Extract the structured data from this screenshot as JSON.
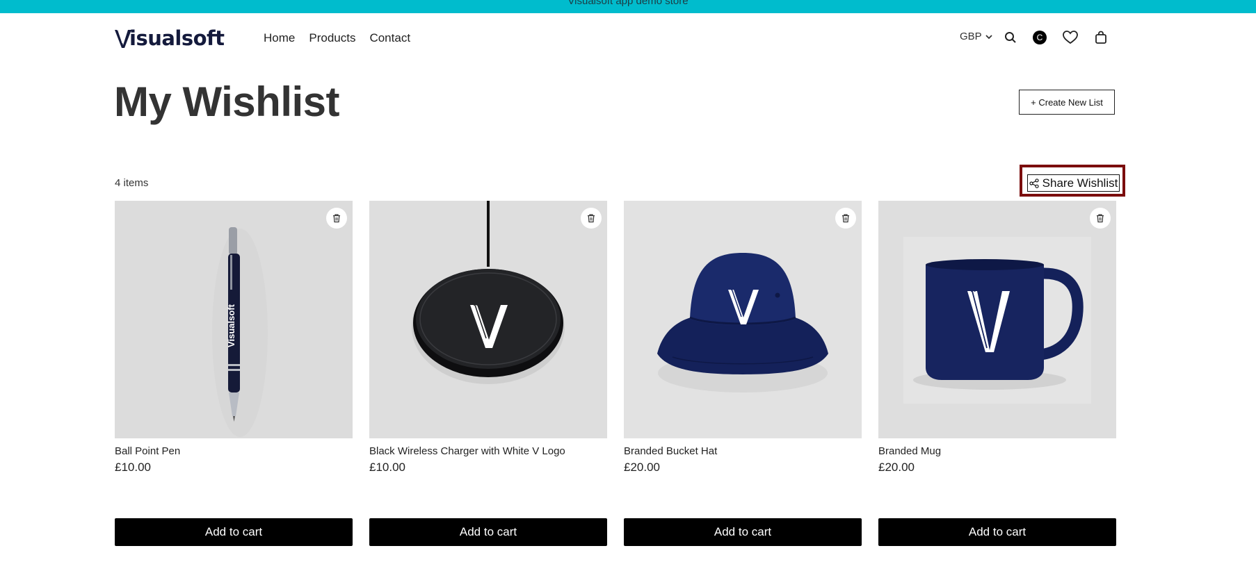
{
  "announcement": "Visualsoft app demo store",
  "header": {
    "logo_text": "isualsoft",
    "logo_letter": "V",
    "nav": [
      "Home",
      "Products",
      "Contact"
    ],
    "currency": "GBP",
    "account_initial": "C",
    "icons": [
      "search-icon",
      "account-icon",
      "heart-icon",
      "bag-icon"
    ]
  },
  "page": {
    "title": "My Wishlist",
    "create_list_label": "+ Create New List",
    "items_count": "4 items",
    "share_label": "Share Wishlist"
  },
  "products": [
    {
      "name": "Ball Point Pen",
      "price": "£10.00",
      "cta": "Add to cart",
      "image": "pen"
    },
    {
      "name": "Black Wireless Charger with White V Logo",
      "price": "£10.00",
      "cta": "Add to cart",
      "image": "charger"
    },
    {
      "name": "Branded Bucket Hat",
      "price": "£20.00",
      "cta": "Add to cart",
      "image": "hat"
    },
    {
      "name": "Branded Mug",
      "price": "£20.00",
      "cta": "Add to cart",
      "image": "mug"
    }
  ],
  "colors": {
    "announcement_bg": "#00bccd",
    "highlight_border": "#7b0d0d",
    "button_bg": "#000000",
    "product_navy": "#14215a"
  }
}
